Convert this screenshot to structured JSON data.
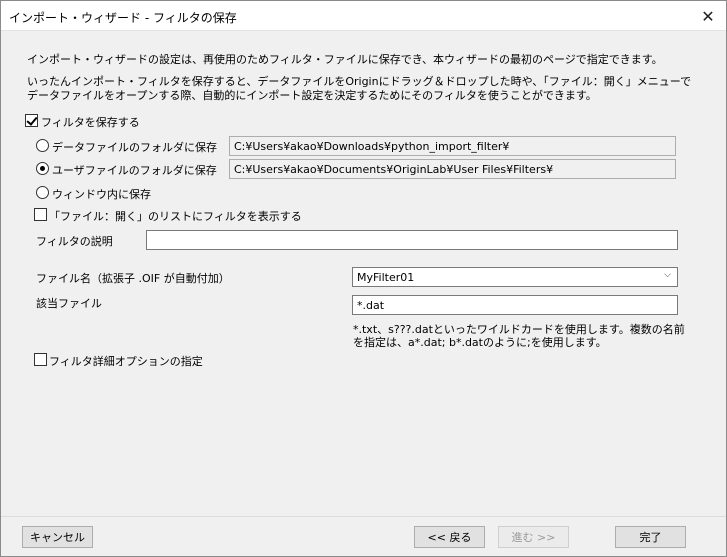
{
  "window": {
    "title": "インポート・ウィザード - フィルタの保存",
    "close_glyph": "✕"
  },
  "description": {
    "line1": "インポート・ウィザードの設定は、再使用のためフィルタ・ファイルに保存でき、本ウィザードの最初のページで指定できます。",
    "line2": "いったんインポート・フィルタを保存すると、データファイルをOriginにドラッグ＆ドロップした時や、「ファイル：開く」メニューで",
    "line3": "データファイルをオープンする際、自動的にインポート設定を決定するためにそのフィルタを使うことができます。"
  },
  "save_filter": {
    "label": "フィルタを保存する",
    "checked": true
  },
  "locations": [
    {
      "label": "データファイルのフォルダに保存",
      "path": "C:¥Users¥akao¥Downloads¥python_import_filter¥",
      "selected": false
    },
    {
      "label": "ユーザファイルのフォルダに保存",
      "path": "C:¥Users¥akao¥Documents¥OriginLab¥User Files¥Filters¥",
      "selected": true
    },
    {
      "label": "ウィンドウ内に保存",
      "selected": false
    }
  ],
  "show_in_open_list": {
    "label": "「ファイル：開く」のリストにフィルタを表示する",
    "checked": false
  },
  "filter_description": {
    "label": "フィルタの説明",
    "value": ""
  },
  "filename": {
    "label": "ファイル名（拡張子 .OIF が自動付加）",
    "value": "MyFilter01"
  },
  "target_files": {
    "label": "該当ファイル",
    "value": "*.dat",
    "hint_line1": "*.txt、s???.datといったワイルドカードを使用します。複数の名前",
    "hint_line2": "を指定は、a*.dat; b*.datのように;を使用します。"
  },
  "advanced_options": {
    "label": "フィルタ詳細オプションの指定",
    "checked": false
  },
  "buttons": {
    "cancel": "キャンセル",
    "back": "<< 戻る",
    "next": "進む >>",
    "finish": "完了"
  }
}
